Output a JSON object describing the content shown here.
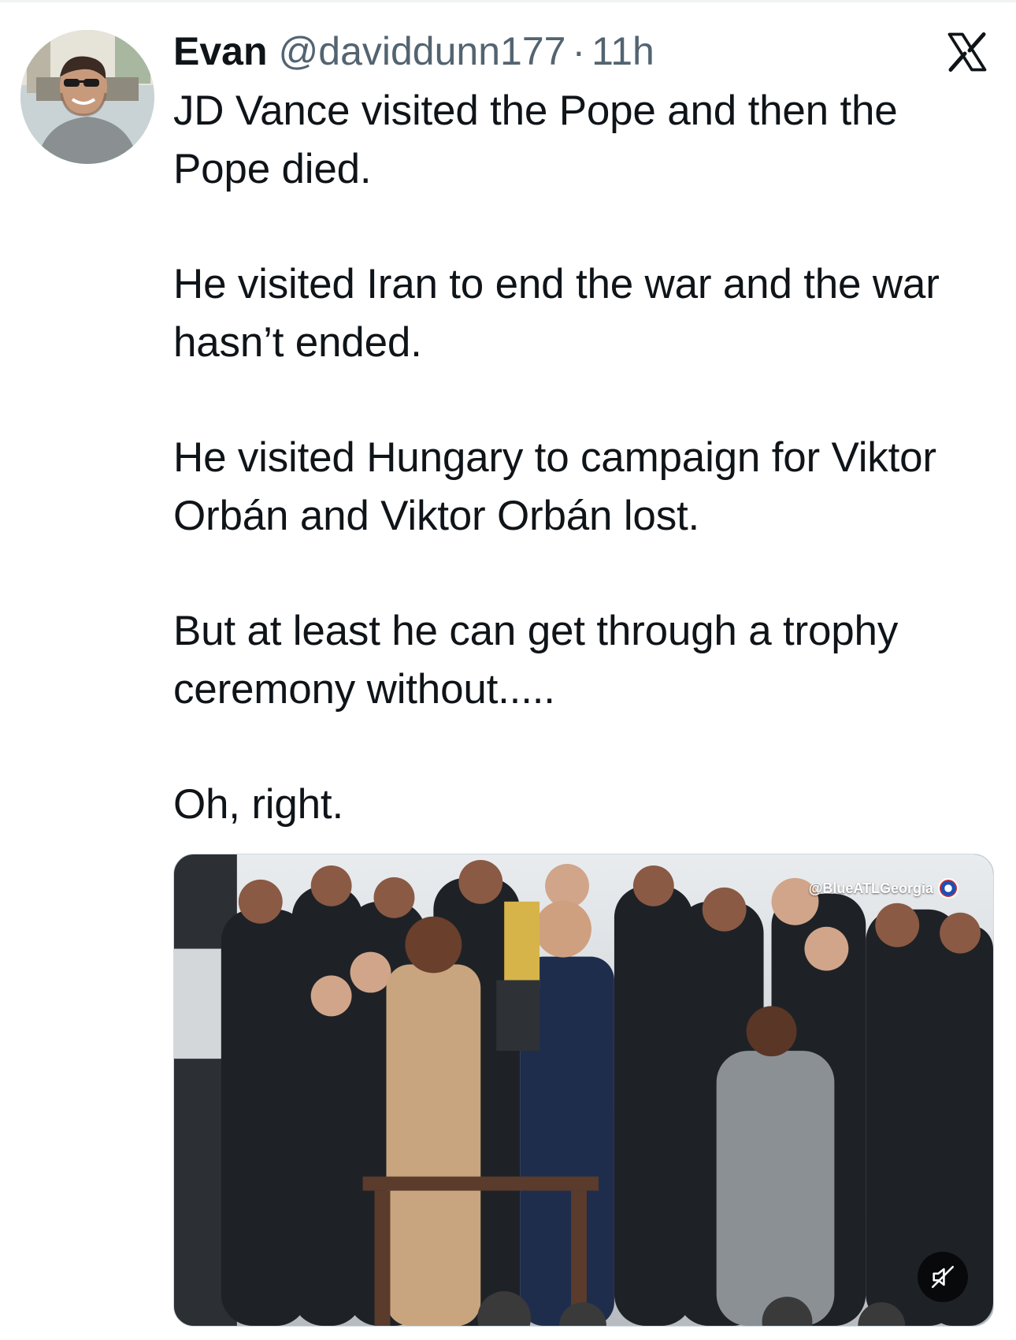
{
  "author": {
    "name": "Evan",
    "handle": "@daviddunn177",
    "separator": "·",
    "time": "11h"
  },
  "icons": {
    "avatar": "avatar-photo",
    "platform": "x-logo-icon",
    "mute": "speaker-muted-icon"
  },
  "tweet": {
    "paragraphs": [
      "JD Vance visited the Pope and then the Pope died.",
      "He visited Iran to end the war and the war hasn’t ended.",
      "He visited Hungary to campaign for Viktor Orbán and Viktor Orbán lost.",
      "But at least he can get through a trophy ceremony without.....",
      "Oh, right."
    ]
  },
  "media": {
    "type": "video",
    "watermark": "@BlueATLGeorgia"
  },
  "colors": {
    "text": "#0f1419",
    "secondary_text": "#536471"
  }
}
